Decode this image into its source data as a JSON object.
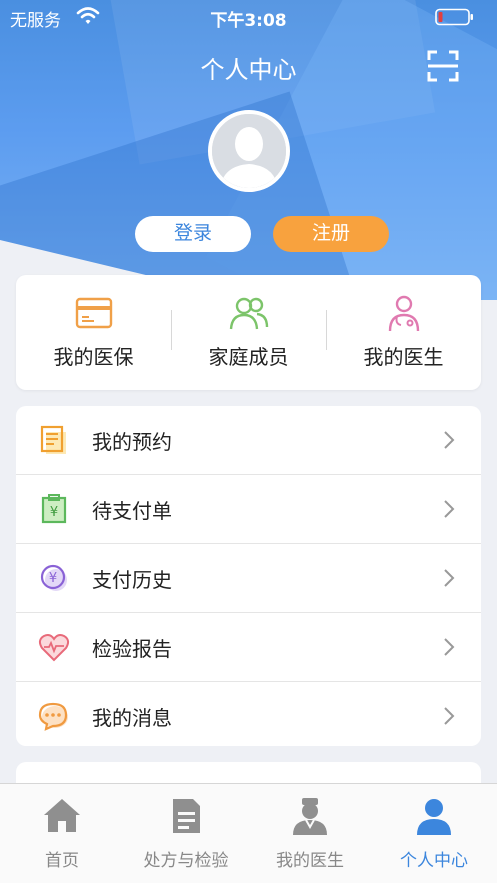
{
  "status": {
    "carrier": "无服务",
    "time": "下午3:08"
  },
  "header": {
    "title": "个人中心"
  },
  "auth": {
    "login_label": "登录",
    "register_label": "注册"
  },
  "quick_links": [
    {
      "label": "我的医保",
      "icon": "medical-card-icon"
    },
    {
      "label": "家庭成员",
      "icon": "family-icon"
    },
    {
      "label": "我的医生",
      "icon": "doctor-icon"
    }
  ],
  "menu": [
    {
      "label": "我的预约",
      "icon": "appointment-icon"
    },
    {
      "label": "待支付单",
      "icon": "pending-payment-icon"
    },
    {
      "label": "支付历史",
      "icon": "payment-history-icon"
    },
    {
      "label": "检验报告",
      "icon": "test-report-icon"
    },
    {
      "label": "我的消息",
      "icon": "message-icon"
    }
  ],
  "tabs": [
    {
      "label": "首页",
      "icon": "home-icon"
    },
    {
      "label": "处方与检验",
      "icon": "prescription-icon"
    },
    {
      "label": "我的医生",
      "icon": "doctor-tab-icon"
    },
    {
      "label": "个人中心",
      "icon": "profile-icon",
      "active": true
    }
  ],
  "colors": {
    "primary": "#3c86dd",
    "accent": "#f8a23e",
    "background": "#eef0f5"
  }
}
